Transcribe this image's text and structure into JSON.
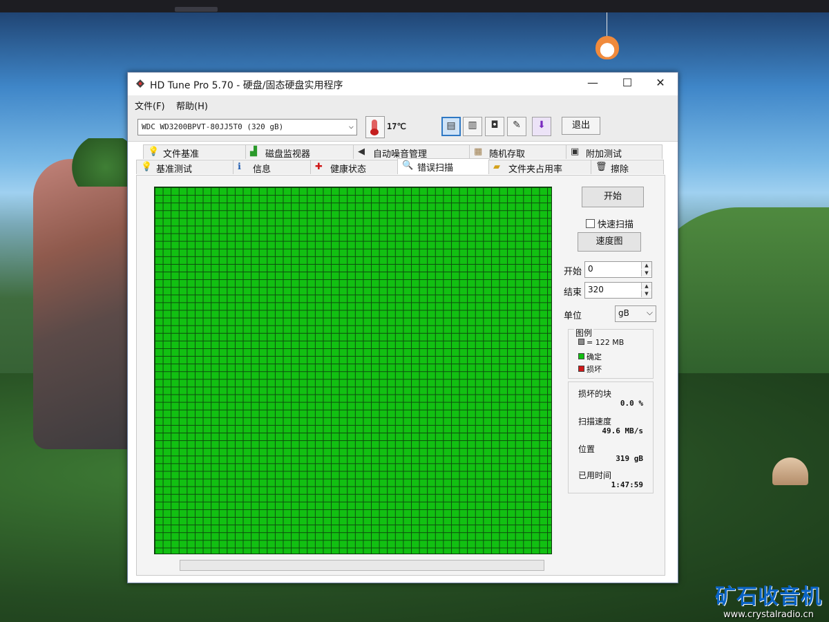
{
  "window": {
    "title": "HD Tune Pro 5.70 - 硬盘/固态硬盘实用程序",
    "minimize": "—",
    "maximize": "☐",
    "close": "✕"
  },
  "menu": {
    "file": "文件(F)",
    "help": "帮助(H)"
  },
  "toolbar": {
    "drive": "WDC WD3200BPVT-80JJ5T0 (320 gB)",
    "temperature": "17℃",
    "exit": "退出"
  },
  "tabs": {
    "row1": [
      {
        "label": "文件基准",
        "icon": "bulb-icon"
      },
      {
        "label": "磁盘监视器",
        "icon": "chart-icon"
      },
      {
        "label": "自动噪音管理",
        "icon": "speaker-icon"
      },
      {
        "label": "随机存取",
        "icon": "dice-icon"
      },
      {
        "label": "附加测试",
        "icon": "window-icon"
      }
    ],
    "row2": [
      {
        "label": "基准测试",
        "icon": "bulb-icon"
      },
      {
        "label": "信息",
        "icon": "info-icon"
      },
      {
        "label": "健康状态",
        "icon": "cross-icon"
      },
      {
        "label": "错误扫描",
        "icon": "magnifier-icon"
      },
      {
        "label": "文件夹占用率",
        "icon": "folder-icon"
      },
      {
        "label": "擦除",
        "icon": "trash-icon"
      }
    ],
    "selected": "错误扫描"
  },
  "error_scan": {
    "start_button": "开始",
    "quick_scan_label": "快速扫描",
    "quick_scan_checked": false,
    "speed_map_button": "速度图",
    "start_label": "开始",
    "start_value": "0",
    "end_label": "结束",
    "end_value": "320",
    "unit_label": "单位",
    "unit_value": "gB",
    "legend": {
      "title": "图例",
      "block_size": "= 122 MB",
      "ok": "确定",
      "bad": "损坏",
      "colors": {
        "block": "#8a8a8a",
        "ok": "#12c012",
        "bad": "#d01818"
      }
    },
    "stats": {
      "damaged_blocks_label": "损坏的块",
      "damaged_blocks_value": "0.0 %",
      "scan_speed_label": "扫描速度",
      "scan_speed_value": "49.6 MB/s",
      "position_label": "位置",
      "position_value": "319 gB",
      "elapsed_label": "已用时间",
      "elapsed_value": "1:47:59"
    },
    "grid_color": "#12c012"
  },
  "watermark": {
    "title": "矿石收音机",
    "url": "www.crystalradio.cn"
  }
}
